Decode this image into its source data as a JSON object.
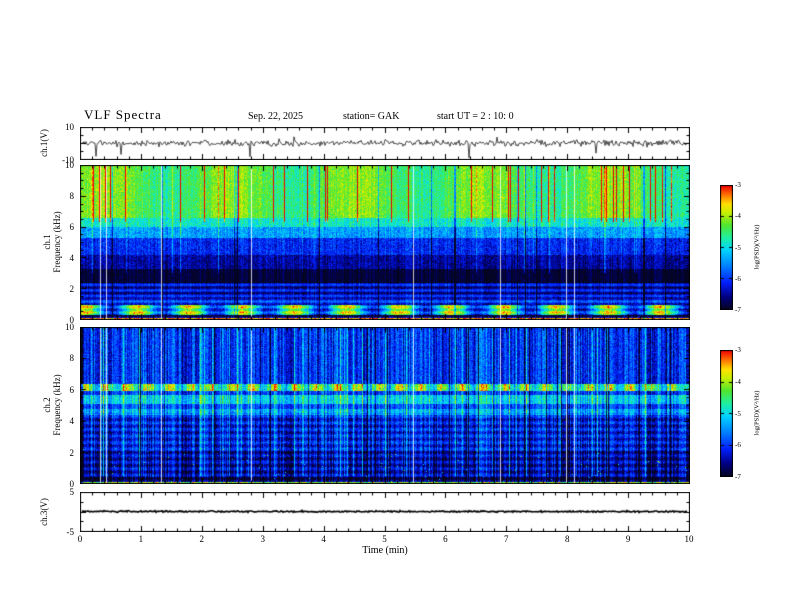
{
  "header": {
    "title": "VLF  Spectra",
    "date": "Sep. 22, 2025",
    "station": "station= GAK",
    "start_ut": "start UT =  2 : 10: 0"
  },
  "xaxis": {
    "label": "Time  (min)",
    "lim": [
      0,
      10
    ],
    "major_ticks": [
      0,
      1,
      2,
      3,
      4,
      5,
      6,
      7,
      8,
      9,
      10
    ],
    "minor_step": 0.2
  },
  "colorbars": [
    {
      "label": "log(PSD)(V²/Hz)",
      "ticks": [
        -3,
        -4,
        -5,
        -6,
        -7
      ],
      "vmin": -7,
      "vmax": -3
    },
    {
      "label": "log(PSD)(V²/Hz)",
      "ticks": [
        -3,
        -4,
        -5,
        -6,
        -7
      ],
      "vmin": -7,
      "vmax": -3
    }
  ],
  "colormap_stops": [
    {
      "t": 0.0,
      "c": "#05051e"
    },
    {
      "t": 0.1,
      "c": "#000080"
    },
    {
      "t": 0.22,
      "c": "#0020ff"
    },
    {
      "t": 0.35,
      "c": "#0080ff"
    },
    {
      "t": 0.48,
      "c": "#00d5ff"
    },
    {
      "t": 0.58,
      "c": "#20f0a0"
    },
    {
      "t": 0.68,
      "c": "#50e630"
    },
    {
      "t": 0.78,
      "c": "#c8f000"
    },
    {
      "t": 0.85,
      "c": "#ffe000"
    },
    {
      "t": 0.92,
      "c": "#ff7800"
    },
    {
      "t": 1.0,
      "c": "#f00000"
    }
  ],
  "dropout_count": 8,
  "chart_data": [
    {
      "id": "ch1_wave",
      "type": "line",
      "ylabel": "ch.1(V)",
      "xlim": [
        0,
        10
      ],
      "ylim": [
        -10,
        10
      ],
      "yticks": [
        10,
        -10
      ],
      "tick_marks": [
        10,
        0,
        -10
      ],
      "y_minor_step": 5,
      "noise_sigma": 1.0,
      "spike_prob": 0.015,
      "line_width": 0.7,
      "seed": 5,
      "description": "Broadband noise trace around 0 V (approx. ±2 V) over 0-10 min with intermittent impulsive spikes, mostly negative, reaching near -10 V."
    },
    {
      "id": "ch1_spec",
      "type": "heatmap",
      "ylabel_ch": "ch.1",
      "ylabel_freq": "Frequency (kHz)",
      "xlim": [
        0,
        10
      ],
      "ylim": [
        0,
        10
      ],
      "yticks": [
        0,
        2,
        4,
        6,
        8,
        10
      ],
      "zlim": [
        -7,
        -3
      ],
      "zlabel": "log(PSD)(V²/Hz)",
      "seed": 7,
      "col_noise": 0.22,
      "stripe_below": 2.45,
      "stripe_amp": 0.4,
      "stripe_period": 0.36,
      "dark_prob": 0.02,
      "bright_prob": 0.03,
      "bright_fmin": 3.0,
      "bright_boost": 0.6,
      "top_streaks": {
        "prob": 0.055,
        "fmin": 6.3,
        "boost": 1.7
      },
      "profile": [
        {
          "f0": 0.0,
          "f1": 0.12,
          "v": -3.8,
          "noise": 0.4
        },
        {
          "f0": 0.12,
          "f1": 0.3,
          "v": -6.7,
          "noise": 0.3
        },
        {
          "f0": 0.3,
          "f1": 0.95,
          "v": -5.0,
          "noise": 0.35,
          "wobble": 1.2,
          "wf": 0.12,
          "ph": 1.0
        },
        {
          "f0": 0.95,
          "f1": 1.4,
          "v": -6.1,
          "noise": 0.3
        },
        {
          "f0": 1.4,
          "f1": 2.4,
          "v": -6.35,
          "noise": 0.25
        },
        {
          "f0": 2.4,
          "f1": 3.3,
          "v": -6.9,
          "noise": 0.15
        },
        {
          "f0": 3.3,
          "f1": 4.2,
          "v": -6.5,
          "noise": 0.3
        },
        {
          "f0": 4.2,
          "f1": 5.3,
          "v": -6.1,
          "noise": 0.35
        },
        {
          "f0": 5.3,
          "f1": 6.0,
          "v": -5.4,
          "noise": 0.4
        },
        {
          "f0": 6.0,
          "f1": 6.6,
          "v": -4.85,
          "noise": 0.35
        },
        {
          "f0": 6.6,
          "f1": 10.0,
          "v": -4.35,
          "noise": 0.3,
          "wobble": 0.3,
          "wf": 0.05,
          "ph": 0.3
        }
      ],
      "description": "Ch.1 spectrogram 0-10 kHz over 0-10 min: intense green/yellow hiss with red vertical bursts above ~6 kHz (~-4 log PSD), blue background 3-6 kHz, a near-black quiet band 2.4-3.3 kHz (~-7), striped blue 1-2.4 kHz, orange/yellow patchy band 0.3-0.9 kHz, bright line at 0 kHz."
    },
    {
      "id": "ch2_spec",
      "type": "heatmap",
      "ylabel_ch": "ch.2",
      "ylabel_freq": "Frequency (kHz)",
      "xlim": [
        0,
        10
      ],
      "ylim": [
        0,
        10
      ],
      "yticks": [
        0,
        2,
        4,
        6,
        8,
        10
      ],
      "zlim": [
        -7,
        -3
      ],
      "zlabel": "log(PSD)(V²/Hz)",
      "seed": 13,
      "col_noise": 0.5,
      "stripe_below": 4.5,
      "stripe_amp": 0.28,
      "stripe_period": 0.42,
      "dark_prob": 0.05,
      "bright_prob": 0.07,
      "bright_fmin": 0.5,
      "bright_boost": 0.8,
      "speckle": {
        "prob": 0.005,
        "fmax": 2.2,
        "boost": 1.7
      },
      "profile": [
        {
          "f0": 0.0,
          "f1": 0.12,
          "v": -4.3,
          "noise": 0.6
        },
        {
          "f0": 0.12,
          "f1": 0.4,
          "v": -6.75,
          "noise": 0.2
        },
        {
          "f0": 0.4,
          "f1": 2.1,
          "v": -6.45,
          "noise": 0.3
        },
        {
          "f0": 2.1,
          "f1": 4.4,
          "v": -6.2,
          "noise": 0.35
        },
        {
          "f0": 4.4,
          "f1": 4.75,
          "v": -5.35,
          "noise": 0.35
        },
        {
          "f0": 4.75,
          "f1": 5.1,
          "v": -5.9,
          "noise": 0.3
        },
        {
          "f0": 5.1,
          "f1": 5.65,
          "v": -5.1,
          "noise": 0.35
        },
        {
          "f0": 5.65,
          "f1": 5.95,
          "v": -6.0,
          "noise": 0.3
        },
        {
          "f0": 5.95,
          "f1": 6.35,
          "v": -4.5,
          "noise": 0.45,
          "wobble": 0.7,
          "wf": 0.3,
          "ph": 0.0
        },
        {
          "f0": 6.35,
          "f1": 10.0,
          "v": -6.05,
          "noise": 0.35
        }
      ],
      "description": "Ch.2 spectrogram 0-10 kHz over 0-10 min: predominantly blue (~-6) with dense vertical cyan streaks, an intermittent orange/yellow band near 6-6.3 kHz (~-4.5), green bands near 4.4-4.75 and 5.1-5.65 kHz, horizontally striped dark-blue region below ~4.5 kHz with scattered green speckles below ~2 kHz, bright multicolored line at 0 kHz."
    },
    {
      "id": "ch3_wave",
      "type": "line",
      "ylabel": "ch.3(V)",
      "xlim": [
        0,
        10
      ],
      "ylim": [
        -5,
        5
      ],
      "yticks": [
        5,
        -5
      ],
      "tick_marks": [
        5,
        0,
        -5
      ],
      "y_minor_step": 2.5,
      "noise_sigma": 0.1,
      "spike_prob": 0,
      "line_width": 1.6,
      "seed": 9,
      "description": "Flat trace at 0 V for the full 0-10 min interval (channel inactive)."
    }
  ]
}
